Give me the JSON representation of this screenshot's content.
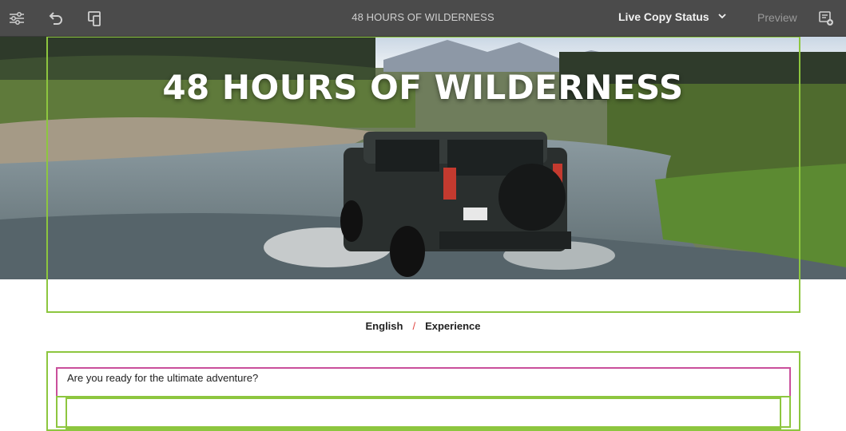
{
  "toolbar": {
    "title": "48 HOURS OF WILDERNESS",
    "status_label": "Live Copy Status",
    "preview_label": "Preview",
    "icons": [
      "sliders-icon",
      "undo-icon",
      "emulator-icon",
      "annotate-icon",
      "chevron-down-icon"
    ]
  },
  "hero": {
    "title": "48 HOURS OF WILDERNESS",
    "image_description": "off-road vehicle driving through a river"
  },
  "breadcrumb": {
    "items": [
      "English",
      "Experience"
    ],
    "separator": "/"
  },
  "content": {
    "question": "Are you ready for the ultimate adventure?"
  },
  "colors": {
    "toolbar_bg": "#4b4b4b",
    "component_outline": "#8dc63f",
    "selected_outline": "#c94f9b",
    "breadcrumb_separator": "#e0433f"
  }
}
